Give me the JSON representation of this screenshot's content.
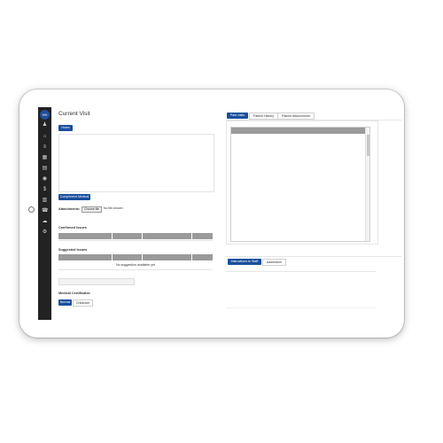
{
  "page": {
    "title": "Current Visit"
  },
  "sidebar": {
    "logo_text": "HH",
    "icons": [
      "person-icon",
      "home-icon",
      "list-icon",
      "calendar-icon",
      "document-icon",
      "eye-icon",
      "dollar-icon",
      "chart-icon",
      "phone-icon",
      "cloud-icon",
      "settings-icon"
    ],
    "glyphs": [
      "♟",
      "⌂",
      "≡",
      "▦",
      "▤",
      "◉",
      "$",
      "▥",
      "☎",
      "☁",
      "⚙"
    ]
  },
  "notes": {
    "tab_label": "Notes",
    "compliment_button": "Compliment Medical"
  },
  "attachments": {
    "label": "Attachments:",
    "choose_file_button": "Choose file",
    "no_file_text": "No file chosen"
  },
  "confirmed_issues": {
    "label": "Confirmed Issues"
  },
  "suggested_issues": {
    "label": "Suggested Issues",
    "empty_text": "No suggestion available yet"
  },
  "medical_certificates": {
    "label": "Medical Certificates",
    "options": [
      "Normal",
      "Childcare"
    ]
  },
  "right_tabs": [
    "Past visits",
    "Patient History",
    "Patient Attachments"
  ],
  "bottom_tabs": [
    "Instructions to Staff",
    "Addendum"
  ],
  "colors": {
    "accent": "#1a4f9c",
    "sidebar": "#222222",
    "table_header": "#9a9a9a"
  }
}
